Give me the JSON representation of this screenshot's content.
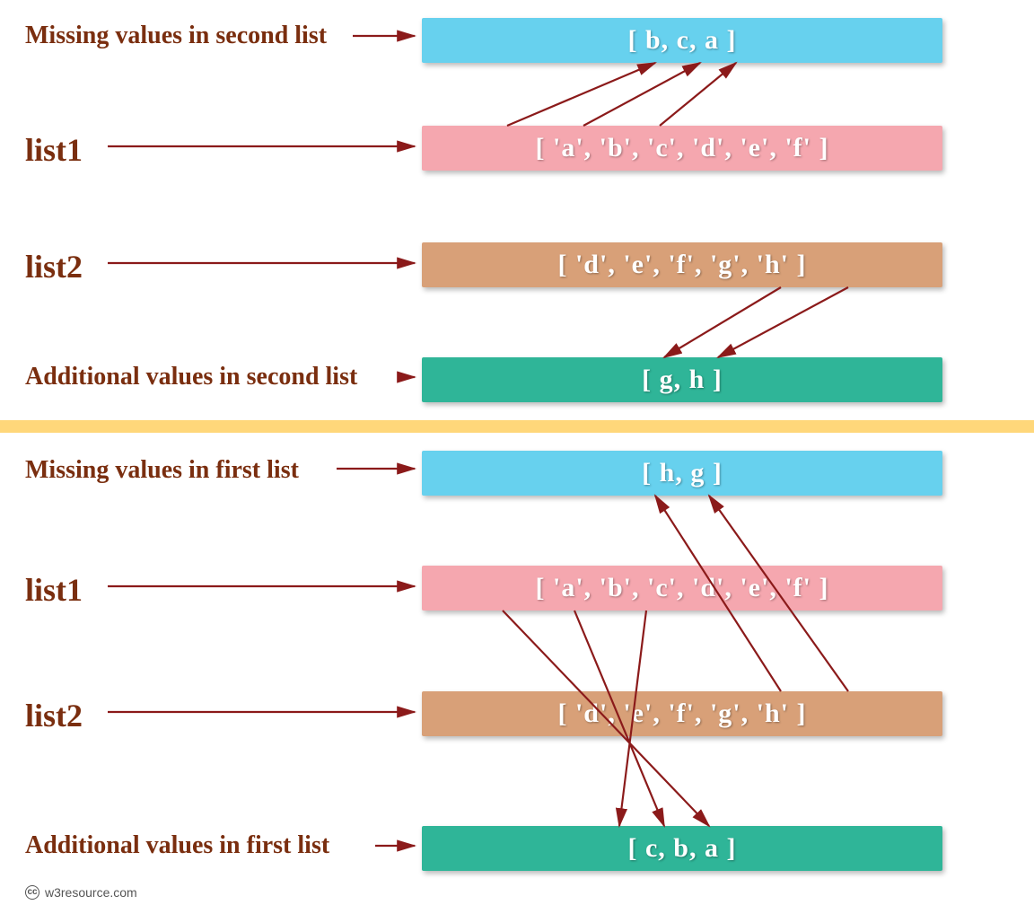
{
  "section1": {
    "missing_label": "Missing values in second list",
    "missing_box": "[  b,   c,   a  ]",
    "list1_label": "list1",
    "list1_box": "[  'a',   'b',   'c',   'd',   'e',   'f'  ]",
    "list2_label": "list2",
    "list2_box": "[  'd',   'e',   'f',   'g',   'h'  ]",
    "additional_label": "Additional values in second list",
    "additional_box": "[  g,   h  ]"
  },
  "section2": {
    "missing_label": "Missing values in first list",
    "missing_box": "[  h,   g  ]",
    "list1_label": "list1",
    "list1_box": "[ 'a',   'b',   'c',   'd',   'e',   'f'  ]",
    "list2_label": "list2",
    "list2_box": "[  'd',   'e',   'f',   'g',   'h'  ]",
    "additional_label": "Additional values in first list",
    "additional_box": "[  c,   b,   a  ]"
  },
  "footer": "w3resource.com",
  "colors": {
    "arrow": "#8b1a1a",
    "cyan": "#67d1ee",
    "pink": "#f5a7af",
    "brown": "#d8a078",
    "teal": "#2fb598",
    "label": "#7a2e0f",
    "divider": "#ffd77a"
  }
}
